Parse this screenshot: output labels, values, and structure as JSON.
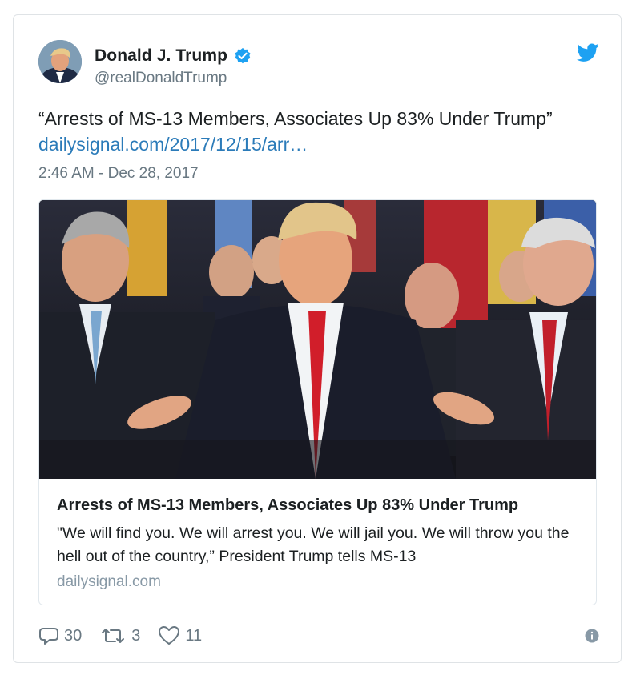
{
  "user": {
    "display_name": "Donald J. Trump",
    "handle": "@realDonaldTrump",
    "verified": true,
    "avatar_icon": "profile-photo"
  },
  "tweet": {
    "text": "“Arrests of MS-13 Members, Associates Up 83% Under Trump”",
    "link": "dailysignal.com/2017/12/15/arr…",
    "timestamp": "2:46 AM - Dec 28, 2017"
  },
  "card": {
    "image_icon": "news-photo",
    "title": "Arrests of MS-13 Members, Associates Up 83% Under Trump",
    "description": "\"We will find you. We will arrest you. We will jail you. We will throw you the hell out of the country,” President Trump tells MS-13",
    "domain": "dailysignal.com"
  },
  "actions": {
    "replies": "30",
    "retweets": "3",
    "likes": "11"
  },
  "colors": {
    "link": "#2b7bb9",
    "twitter_blue": "#1da1f2",
    "muted": "#697882"
  }
}
